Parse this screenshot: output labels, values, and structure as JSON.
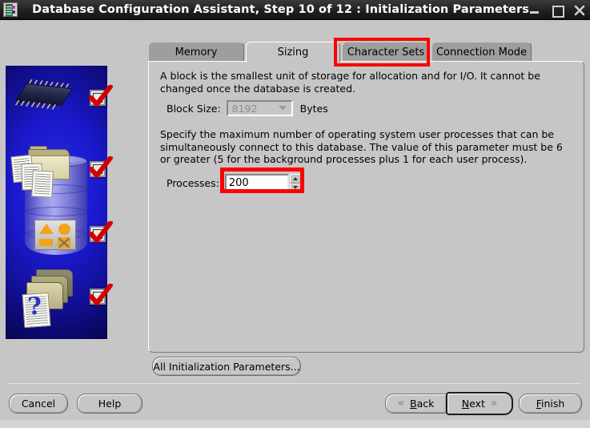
{
  "window": {
    "title": "Database Configuration Assistant, Step 10 of 12 : Initialization Parameters",
    "app_icon": "database-chip-icon",
    "minimize_label": "–",
    "maximize_label": "□",
    "close_label": "✕"
  },
  "sidebar": {
    "image_alt": "database-illustration",
    "checkmarks": [
      "step-complete-check-1",
      "step-complete-check-2",
      "step-complete-check-3",
      "step-complete-check-4"
    ],
    "accent_blue": "#1a18c8"
  },
  "tabs": {
    "items": [
      {
        "label": "Memory",
        "active": false
      },
      {
        "label": "Sizing",
        "active": true
      },
      {
        "label": "Character Sets",
        "active": false
      },
      {
        "label": "Connection Mode",
        "active": false
      }
    ],
    "highlight_color": "#fd0000",
    "highlighted_tab": "Character Sets"
  },
  "panel": {
    "block_paragraph": "A block is the smallest unit of storage for allocation and for I/O. It cannot be changed once the database is created.",
    "block_size": {
      "label": "Block Size:",
      "value": "8192",
      "units": "Bytes",
      "disabled": true
    },
    "processes_paragraph": "Specify the maximum number of operating system user processes that can be simultaneously connect to this database. The value of this parameter must be 6 or greater (5 for the background processes plus 1 for each user process).",
    "processes": {
      "label": "Processes:",
      "value": "200",
      "spinner_up": "increment",
      "spinner_down": "decrement",
      "highlighted": true
    }
  },
  "footer": {
    "all_parameters_label": "All Initialization Parameters...",
    "cancel_label": "Cancel",
    "help_label": "Help",
    "back_label": "Back",
    "back_mnemonic": "B",
    "next_label": "Next",
    "next_mnemonic": "N",
    "finish_label": "Finish",
    "finish_mnemonic": "F",
    "back_icon": "chevron-left-double-icon",
    "next_icon": "chevron-right-double-icon"
  }
}
